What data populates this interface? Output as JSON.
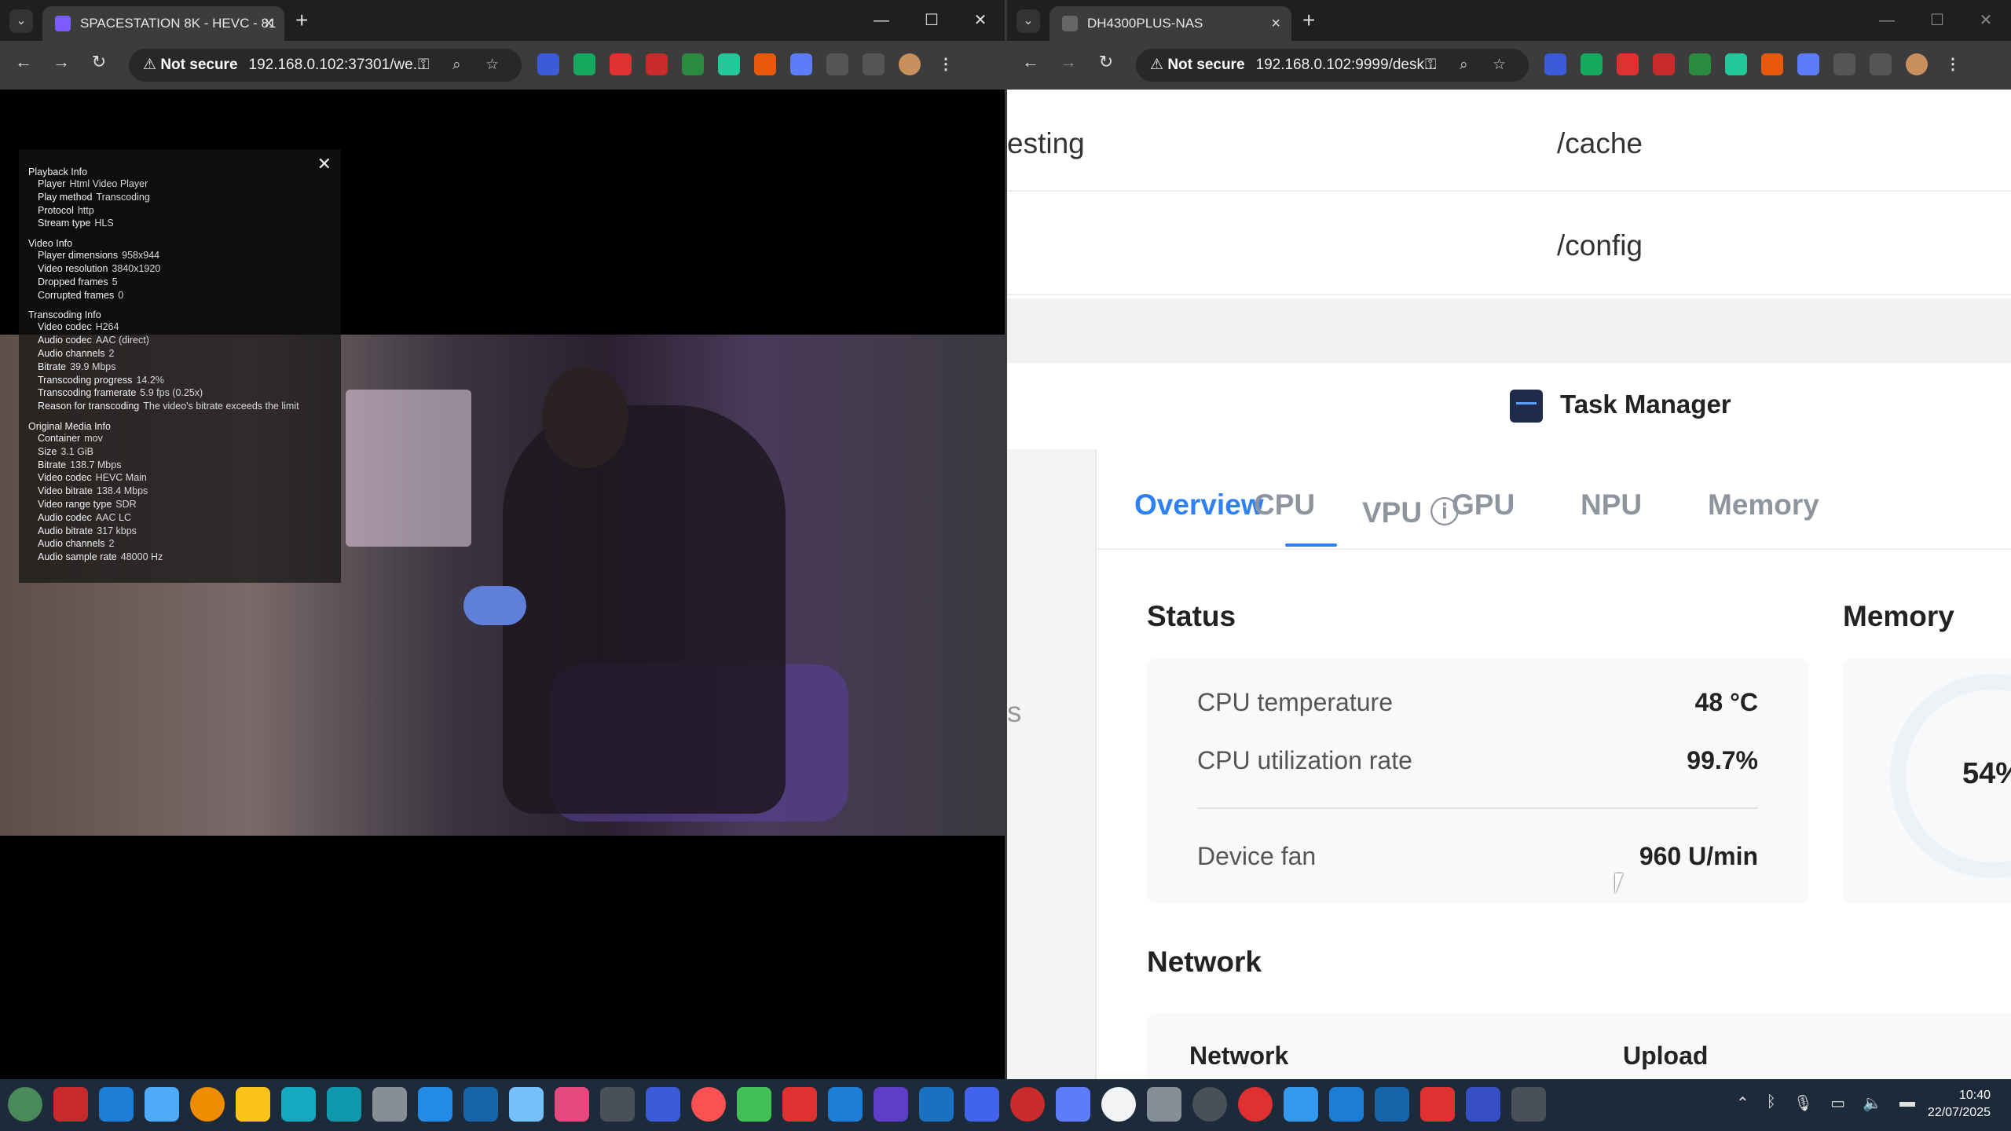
{
  "left_window": {
    "tab_title": "SPACESTATION 8K - HEVC - 81",
    "not_secure": "Not secure",
    "url": "192.168.0.102:37301/we...",
    "playback": {
      "close": "✕",
      "sections": [
        {
          "title": "Playback Info",
          "rows": [
            [
              "Player",
              "Html Video Player"
            ],
            [
              "Play method",
              "Transcoding"
            ],
            [
              "Protocol",
              "http"
            ],
            [
              "Stream type",
              "HLS"
            ]
          ]
        },
        {
          "title": "Video Info",
          "rows": [
            [
              "Player dimensions",
              "958x944"
            ],
            [
              "Video resolution",
              "3840x1920"
            ],
            [
              "Dropped frames",
              "5"
            ],
            [
              "Corrupted frames",
              "0"
            ]
          ]
        },
        {
          "title": "Transcoding Info",
          "rows": [
            [
              "Video codec",
              "H264"
            ],
            [
              "Audio codec",
              "AAC (direct)"
            ],
            [
              "Audio channels",
              "2"
            ],
            [
              "Bitrate",
              "39.9 Mbps"
            ],
            [
              "Transcoding progress",
              "14.2%"
            ],
            [
              "Transcoding framerate",
              "5.9 fps (0.25x)"
            ],
            [
              "Reason for transcoding",
              "The video's bitrate exceeds the limit"
            ]
          ]
        },
        {
          "title": "Original Media Info",
          "rows": [
            [
              "Container",
              "mov"
            ],
            [
              "Size",
              "3.1 GiB"
            ],
            [
              "Bitrate",
              "138.7 Mbps"
            ],
            [
              "Video codec",
              "HEVC Main"
            ],
            [
              "Video bitrate",
              "138.4 Mbps"
            ],
            [
              "Video range type",
              "SDR"
            ],
            [
              "Audio codec",
              "AAC LC"
            ],
            [
              "Audio bitrate",
              "317 kbps"
            ],
            [
              "Audio channels",
              "2"
            ],
            [
              "Audio sample rate",
              "48000 Hz"
            ]
          ]
        }
      ]
    }
  },
  "right_window": {
    "tab_title": "DH4300PLUS-NAS",
    "not_secure": "Not secure",
    "url": "192.168.0.102:9999/desk...",
    "rows": [
      {
        "left": "esting",
        "right": "/cache"
      },
      {
        "left": "",
        "right": "/config"
      }
    ],
    "task_manager": {
      "title": "Task Manager",
      "side_fragment": "s",
      "tabs": [
        "Overview",
        "CPU",
        "VPU ⓘ",
        "GPU",
        "NPU",
        "Memory"
      ],
      "status_title": "Status",
      "status": [
        {
          "label": "CPU temperature",
          "value": "48 °C"
        },
        {
          "label": "CPU utilization rate",
          "value": "99.7%"
        },
        {
          "label": "Device fan",
          "value": "960 U/min"
        }
      ],
      "memory_title": "Memory",
      "memory_pct": "54%",
      "network_title": "Network",
      "network_cols": [
        "Network",
        "Upload"
      ]
    }
  },
  "taskbar": {
    "time": "10:40",
    "date": "22/07/2025"
  },
  "colors": {
    "accent": "#2f7ff5",
    "taskbar": "#1c2a3a"
  }
}
